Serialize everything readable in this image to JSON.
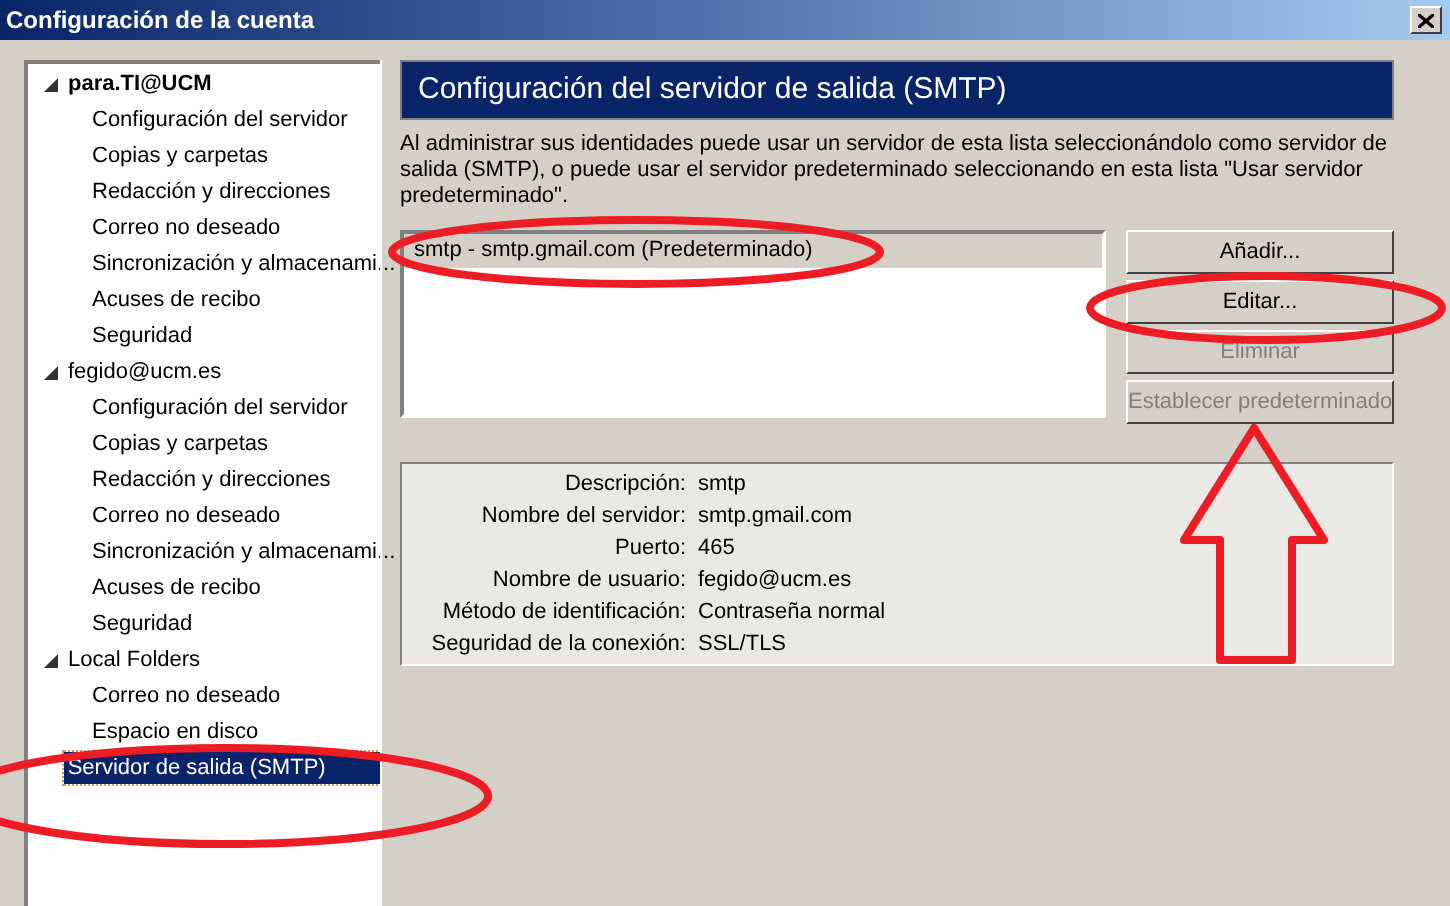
{
  "window": {
    "title": "Configuración de la cuenta"
  },
  "tree": [
    {
      "label": "para.TI@UCM",
      "bold": true,
      "expanded": true,
      "selected": false,
      "children": [
        {
          "label": "Configuración del servidor",
          "selected": false
        },
        {
          "label": "Copias y carpetas",
          "selected": false
        },
        {
          "label": "Redacción y direcciones",
          "selected": false
        },
        {
          "label": "Correo no deseado",
          "selected": false
        },
        {
          "label": "Sincronización y almacenami...",
          "selected": false
        },
        {
          "label": "Acuses de recibo",
          "selected": false
        },
        {
          "label": "Seguridad",
          "selected": false
        }
      ]
    },
    {
      "label": "fegido@ucm.es",
      "bold": false,
      "expanded": true,
      "selected": false,
      "children": [
        {
          "label": "Configuración del servidor",
          "selected": false
        },
        {
          "label": "Copias y carpetas",
          "selected": false
        },
        {
          "label": "Redacción y direcciones",
          "selected": false
        },
        {
          "label": "Correo no deseado",
          "selected": false
        },
        {
          "label": "Sincronización y almacenami...",
          "selected": false
        },
        {
          "label": "Acuses de recibo",
          "selected": false
        },
        {
          "label": "Seguridad",
          "selected": false
        }
      ]
    },
    {
      "label": "Local Folders",
      "bold": false,
      "expanded": true,
      "selected": false,
      "children": [
        {
          "label": "Correo no deseado",
          "selected": false
        },
        {
          "label": "Espacio en disco",
          "selected": false
        }
      ]
    },
    {
      "label": "Servidor de salida (SMTP)",
      "bold": false,
      "selected": true
    }
  ],
  "panel": {
    "title": "Configuración del servidor de salida (SMTP)",
    "description": "Al administrar sus identidades puede usar un servidor de esta lista seleccionándolo como servidor de salida (SMTP), o puede usar el servidor predeterminado seleccionando en esta lista \"Usar servidor predeterminado\".",
    "servers": [
      {
        "label": "smtp - smtp.gmail.com (Predeterminado)",
        "selected": true
      }
    ],
    "buttons": [
      {
        "label": "Añadir...",
        "disabled": false
      },
      {
        "label": "Editar...",
        "disabled": false
      },
      {
        "label": "Eliminar",
        "disabled": true
      },
      {
        "label": "Establecer predeterminado",
        "disabled": true
      }
    ],
    "details": [
      {
        "label": "Descripción:",
        "value": "smtp"
      },
      {
        "label": "Nombre del servidor:",
        "value": "smtp.gmail.com"
      },
      {
        "label": "Puerto:",
        "value": "465"
      },
      {
        "label": "Nombre de usuario:",
        "value": "fegido@ucm.es"
      },
      {
        "label": "Método de identificación:",
        "value": "Contraseña normal"
      },
      {
        "label": "Seguridad de la conexión:",
        "value": "SSL/TLS"
      }
    ]
  }
}
